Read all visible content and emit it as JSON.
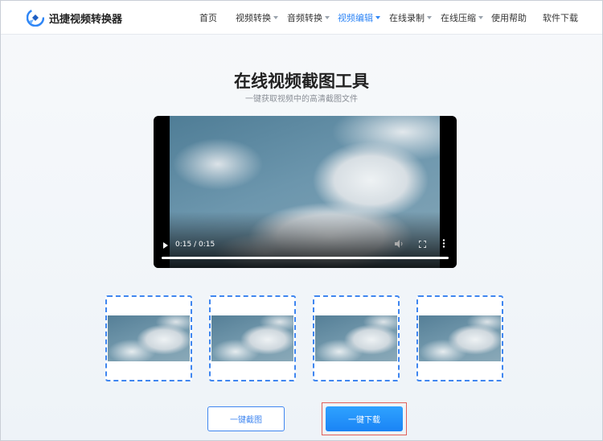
{
  "header": {
    "app_name": "迅捷视频转换器",
    "nav": [
      {
        "label": "首页"
      },
      {
        "label": "视频转换",
        "has_dropdown": true
      },
      {
        "label": "音频转换",
        "has_dropdown": true
      },
      {
        "label": "视频编辑",
        "has_dropdown": true,
        "active": true
      },
      {
        "label": "在线录制",
        "has_dropdown": true
      },
      {
        "label": "在线压缩",
        "has_dropdown": true
      },
      {
        "label": "使用帮助"
      },
      {
        "label": "软件下载"
      }
    ]
  },
  "main": {
    "title": "在线视频截图工具",
    "subtitle": "一键获取视频中的高清截图文件"
  },
  "video_player": {
    "time": "0:15 / 0:15",
    "progress": 1.0
  },
  "thumbnails_count": 4,
  "actions": {
    "capture_label": "一键截图",
    "download_label": "一键下载"
  },
  "colors": {
    "accent": "#2f86f6",
    "thumbnail_border": "#3f86f0",
    "download_button": "#1a84f5",
    "highlight_box": "#e0605a"
  }
}
